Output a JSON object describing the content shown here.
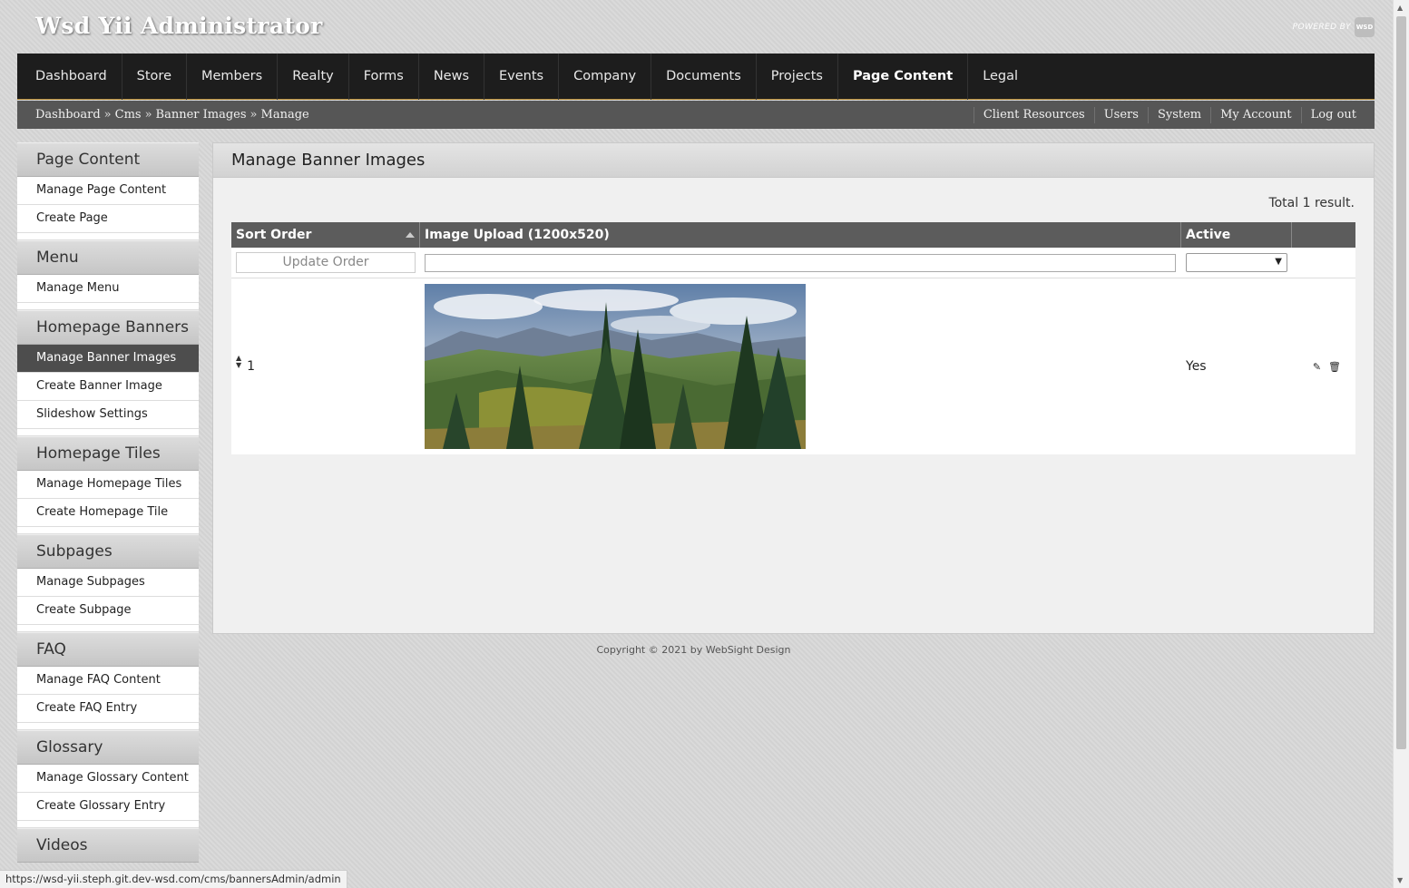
{
  "app": {
    "title": "Wsd Yii Administrator",
    "powered_by": "POWERED BY",
    "logo_text": "WSD"
  },
  "mainnav": {
    "items": [
      {
        "label": "Dashboard"
      },
      {
        "label": "Store"
      },
      {
        "label": "Members"
      },
      {
        "label": "Realty"
      },
      {
        "label": "Forms"
      },
      {
        "label": "News"
      },
      {
        "label": "Events"
      },
      {
        "label": "Company"
      },
      {
        "label": "Documents"
      },
      {
        "label": "Projects"
      },
      {
        "label": "Page Content",
        "active": true
      },
      {
        "label": "Legal"
      }
    ]
  },
  "breadcrumb": {
    "items": [
      "Dashboard",
      "Cms",
      "Banner Images",
      "Manage"
    ],
    "separator": "»"
  },
  "utility_nav": {
    "items": [
      "Client Resources",
      "Users",
      "System",
      "My Account",
      "Log out"
    ]
  },
  "sidebar": {
    "sections": [
      {
        "title": "Page Content",
        "items": [
          "Manage Page Content",
          "Create Page"
        ]
      },
      {
        "title": "Menu",
        "items": [
          "Manage Menu"
        ]
      },
      {
        "title": "Homepage Banners",
        "items": [
          "Manage Banner Images",
          "Create Banner Image",
          "Slideshow Settings"
        ]
      },
      {
        "title": "Homepage Tiles",
        "items": [
          "Manage Homepage Tiles",
          "Create Homepage Tile"
        ]
      },
      {
        "title": "Subpages",
        "items": [
          "Manage Subpages",
          "Create Subpage"
        ]
      },
      {
        "title": "FAQ",
        "items": [
          "Manage FAQ Content",
          "Create FAQ Entry"
        ]
      },
      {
        "title": "Glossary",
        "items": [
          "Manage Glossary Content",
          "Create Glossary Entry"
        ]
      },
      {
        "title": "Videos",
        "items": []
      }
    ],
    "active_item": "Manage Banner Images"
  },
  "main": {
    "title": "Manage Banner Images",
    "summary": "Total 1 result.",
    "grid": {
      "columns": [
        "Sort Order",
        "Image Upload (1200x520)",
        "Active",
        ""
      ],
      "update_order_label": "Update Order",
      "rows": [
        {
          "sort_order": "1",
          "image_alt": "mountain forest banner",
          "active": "Yes"
        }
      ]
    }
  },
  "footer": {
    "copyright": "Copyright © 2021 by WebSight Design"
  },
  "statusbar": {
    "url": "https://wsd-yii.steph.git.dev-wsd.com/cms/bannersAdmin/admin"
  },
  "icons": {
    "edit": "pencil-icon",
    "delete": "trash-icon",
    "sort_asc": "sort-asc-icon",
    "drag": "drag-handle-icon"
  },
  "colors": {
    "nav_bg": "#1d1d1d",
    "nav_accent": "#b58b36",
    "subbar_bg": "#565656",
    "active_side_bg": "#4d4d4d",
    "grid_head_bg": "#5c5c5c"
  }
}
